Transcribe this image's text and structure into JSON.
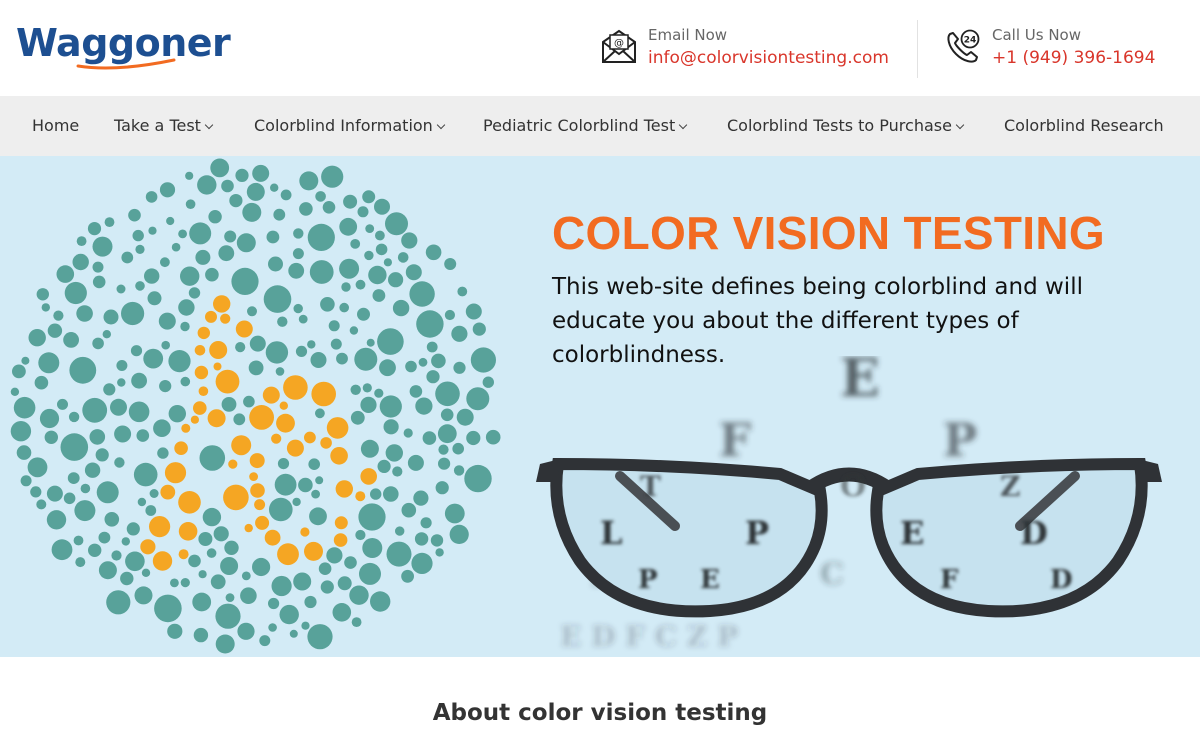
{
  "brand": {
    "name": "Waggoner"
  },
  "contact": {
    "email": {
      "label": "Email Now",
      "value": "info@colorvisiontesting.com",
      "icon": "envelope-icon"
    },
    "phone": {
      "label": "Call Us Now",
      "value": "+1 (949) 396-1694",
      "icon": "phone-24-icon",
      "badge": "24"
    }
  },
  "nav": {
    "items": [
      {
        "label": "Home",
        "dropdown": false
      },
      {
        "label": "Take a Test",
        "dropdown": true
      },
      {
        "label": "Colorblind Information",
        "dropdown": true
      },
      {
        "label": "Pediatric Colorblind Test",
        "dropdown": true
      },
      {
        "label": "Colorblind Tests to Purchase",
        "dropdown": true
      },
      {
        "label": "Colorblind Research",
        "dropdown": false
      }
    ]
  },
  "hero": {
    "title": "COLOR VISION TESTING",
    "description": "This web-site defines being colorblind and will educate you about the different types of colorblindness.",
    "plate_number": "16",
    "eye_chart_rows": [
      "E",
      "F P",
      "T O Z",
      "L P E D",
      "P E C F D",
      "E D F C Z P"
    ]
  },
  "about": {
    "title": "About color vision testing"
  },
  "colors": {
    "brand_blue": "#1d4f91",
    "accent_orange": "#f26b21",
    "contact_red": "#d9362b",
    "hero_bg": "#d3ebf6",
    "plate_teal": "#58a29a",
    "plate_orange": "#f5a623"
  }
}
